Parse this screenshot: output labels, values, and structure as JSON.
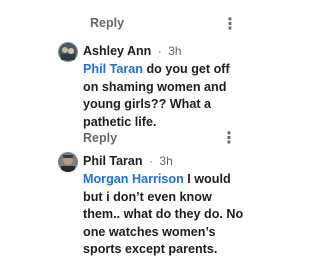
{
  "top_actions": {
    "reply_label": "Reply",
    "more_label": "⋮"
  },
  "comments": [
    {
      "author": "Ashley Ann",
      "separator": "·",
      "time": "3h",
      "mention": "Phil Taran",
      "text": " do you get off on shaming women and young girls?? What a pathetic life.",
      "reply_label": "Reply",
      "more_label": "⋮"
    },
    {
      "author": "Phil Taran",
      "separator": "·",
      "time": "3h",
      "mention": "Morgan Harrison",
      "text": " I would but i don’t even know them.. what do they do. No one watches women’s sports except parents."
    }
  ],
  "colors": {
    "mention": "#216fdb",
    "meta": "#65676b",
    "text": "#1c1e21"
  }
}
